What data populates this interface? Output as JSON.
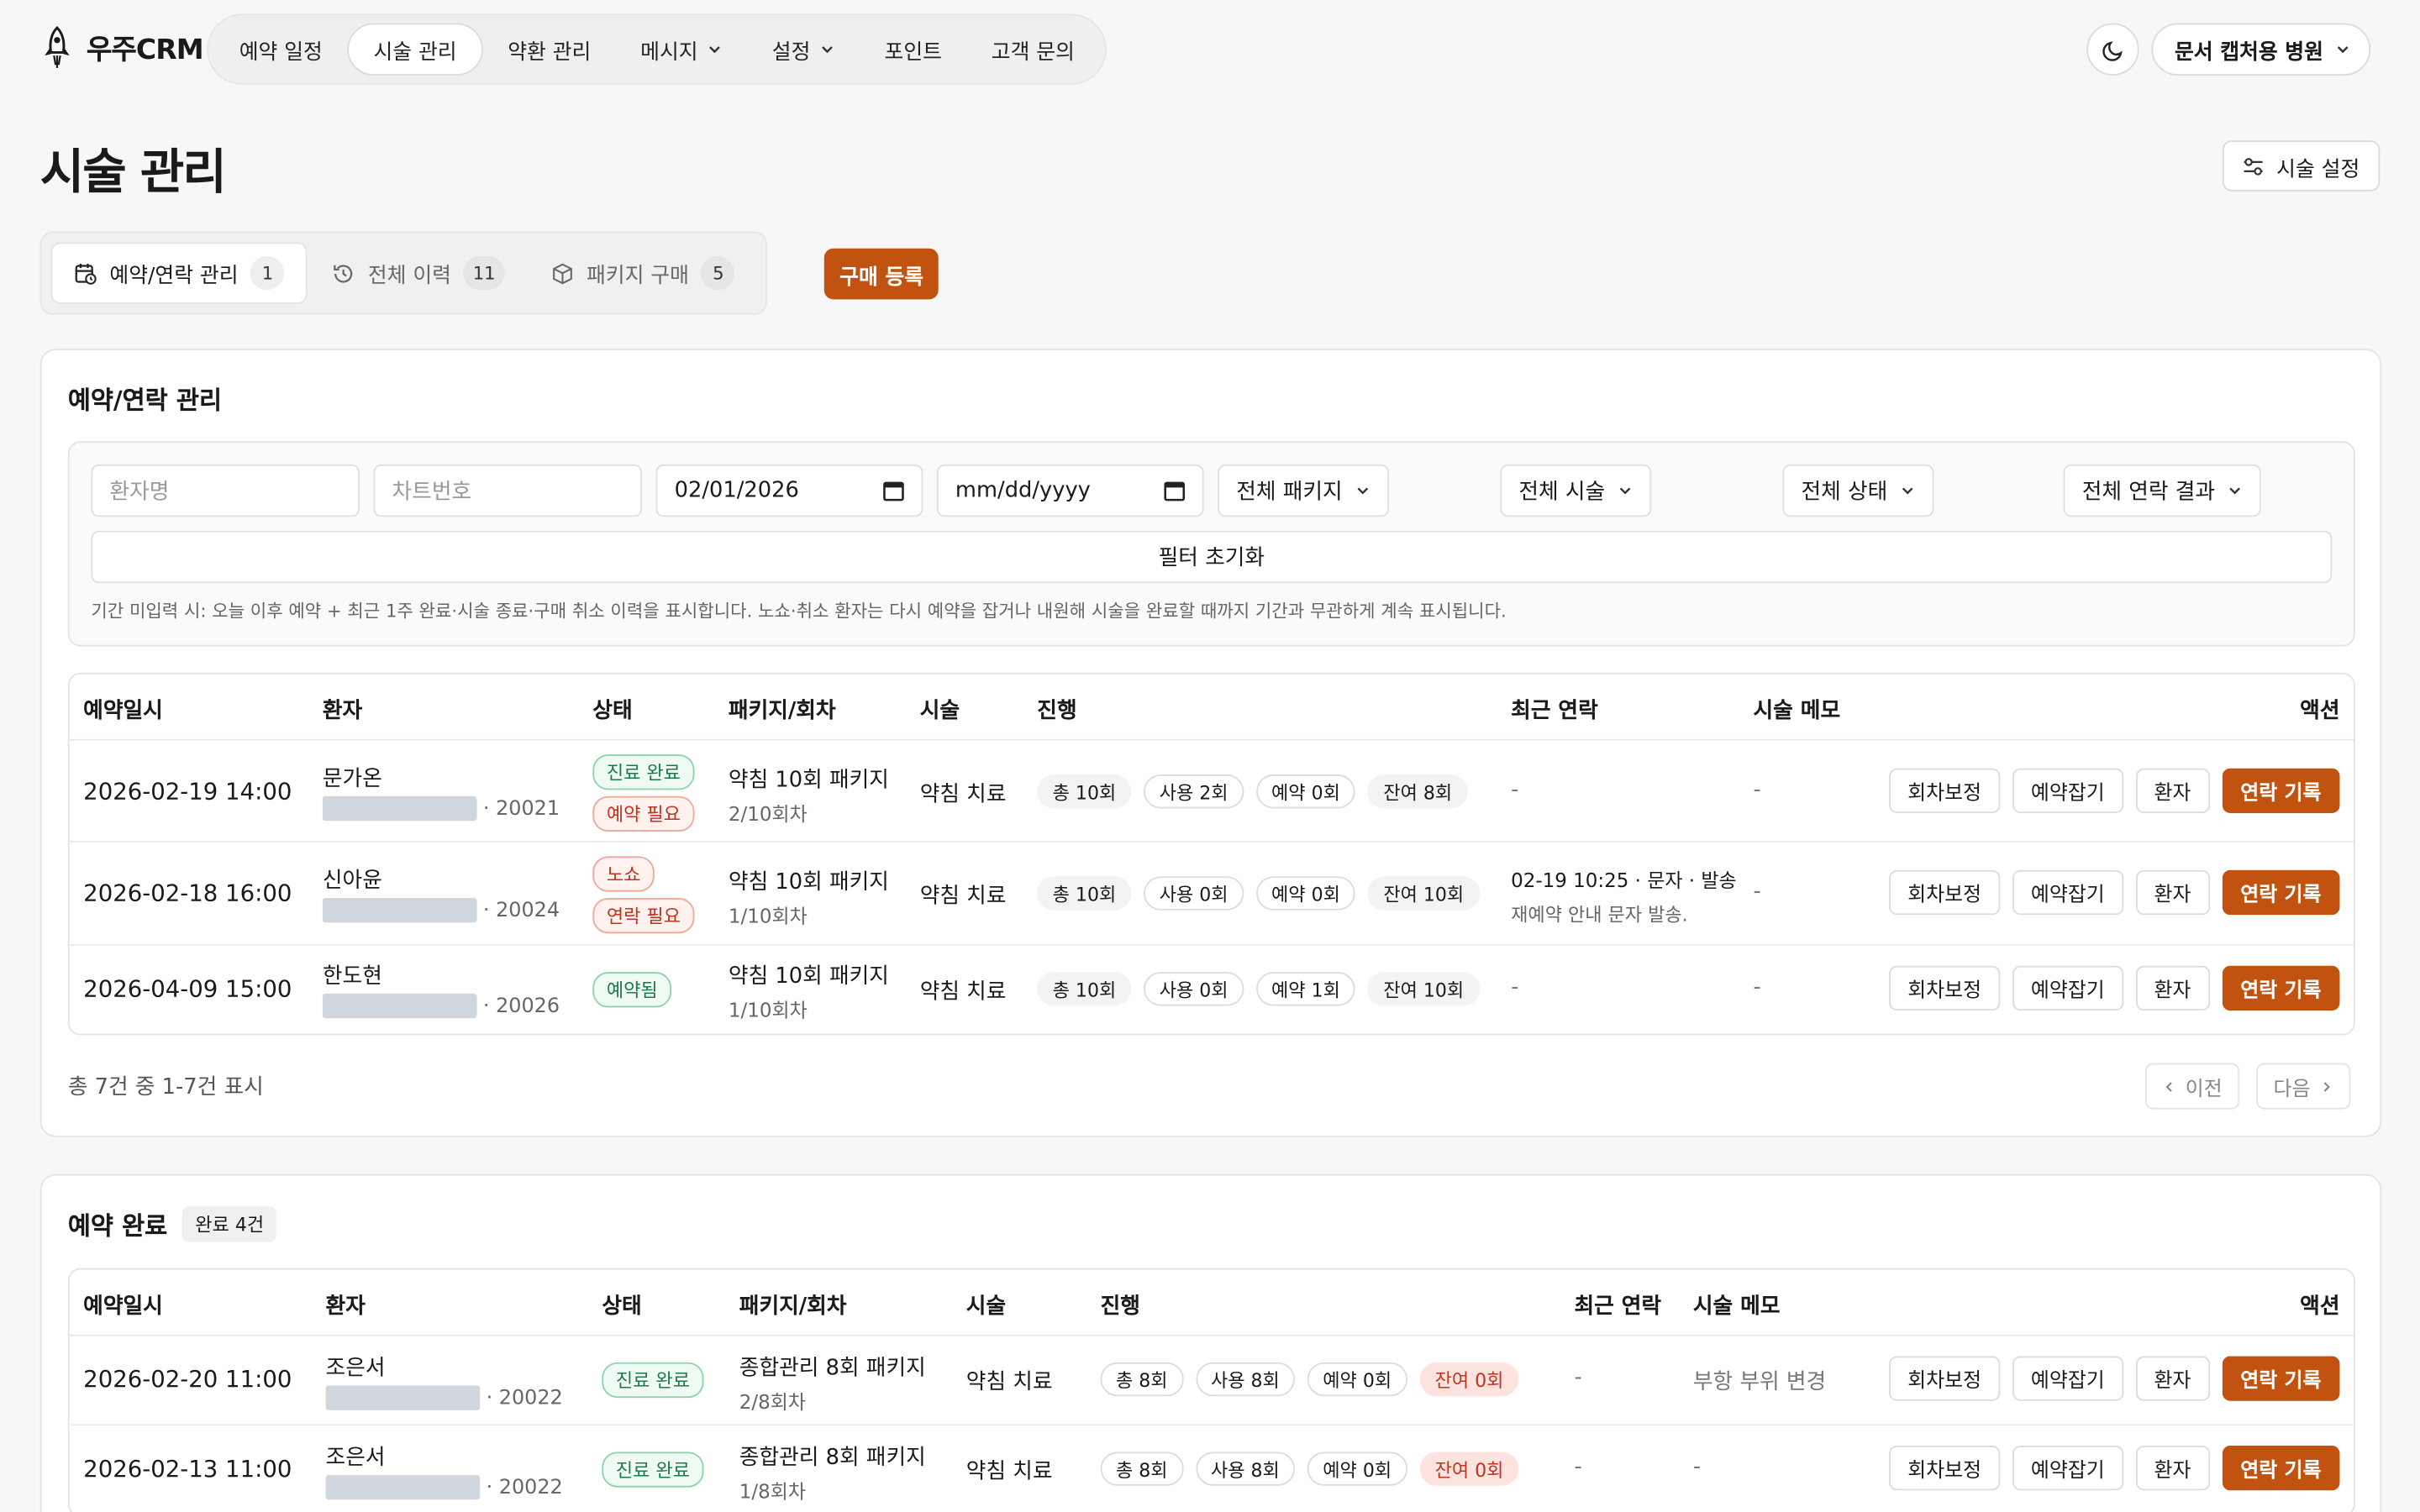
{
  "app": {
    "logo_text": "우주CRM"
  },
  "nav": {
    "items": [
      {
        "label": "예약 일정"
      },
      {
        "label": "시술 관리"
      },
      {
        "label": "약환 관리"
      },
      {
        "label": "메시지"
      },
      {
        "label": "설정"
      },
      {
        "label": "포인트"
      },
      {
        "label": "고객 문의"
      }
    ],
    "clinic": "문서 캡처용 병원"
  },
  "page": {
    "title": "시술 관리",
    "settings_label": "시술 설정"
  },
  "tabs": [
    {
      "label": "예약/연락 관리",
      "count": "1"
    },
    {
      "label": "전체 이력",
      "count": "11"
    },
    {
      "label": "패키지 구매",
      "count": "5"
    }
  ],
  "buy_button": "구매 등록",
  "section1": {
    "title": "예약/연락 관리",
    "filters": {
      "patient_placeholder": "환자명",
      "chart_placeholder": "차트번호",
      "date_from": "02/01/2026",
      "date_to": "mm/dd/yyyy",
      "package": "전체 패키지",
      "procedure": "전체 시술",
      "status": "전체 상태",
      "contact_result": "전체 연락 결과",
      "reset": "필터 초기화",
      "note": "기간 미입력 시: 오늘 이후 예약 + 최근 1주 완료·시술 종료·구매 취소 이력을 표시합니다. 노쇼·취소 환자는 다시 예약을 잡거나 내원해 시술을 완료할 때까지 기간과 무관하게 계속 표시됩니다."
    },
    "columns": [
      "예약일시",
      "환자",
      "상태",
      "패키지/회차",
      "시술",
      "진행",
      "최근 연락",
      "시술 메모",
      "액션"
    ],
    "rows": [
      {
        "datetime": "2026-02-19 14:00",
        "name": "문가온",
        "chart": "· 20021",
        "status": [
          "진료 완료",
          "예약 필요"
        ],
        "package": "약침 10회 패키지",
        "round": "2/10회차",
        "procedure": "약침 치료",
        "chips": [
          "총 10회",
          "사용 2회",
          "예약 0회",
          "잔여 8회"
        ],
        "contact": "-",
        "contact_sub": "",
        "memo": "-"
      },
      {
        "datetime": "2026-02-18 16:00",
        "name": "신아윤",
        "chart": "· 20024",
        "status": [
          "노쇼",
          "연락 필요"
        ],
        "package": "약침 10회 패키지",
        "round": "1/10회차",
        "procedure": "약침 치료",
        "chips": [
          "총 10회",
          "사용 0회",
          "예약 0회",
          "잔여 10회"
        ],
        "contact": "02-19 10:25 · 문자 · 발송",
        "contact_sub": "재예약 안내 문자 발송.",
        "memo": "-"
      },
      {
        "datetime": "2026-04-09 15:00",
        "name": "한도현",
        "chart": "· 20026",
        "status": [
          "예약됨"
        ],
        "package": "약침 10회 패키지",
        "round": "1/10회차",
        "procedure": "약침 치료",
        "chips": [
          "총 10회",
          "사용 0회",
          "예약 1회",
          "잔여 10회"
        ],
        "contact": "-",
        "contact_sub": "",
        "memo": "-"
      }
    ],
    "actions": [
      "회차보정",
      "예약잡기",
      "환자",
      "연락 기록"
    ],
    "pager": {
      "text": "총 7건 중 1-7건 표시",
      "prev": "이전",
      "next": "다음"
    }
  },
  "section2": {
    "title": "예약 완료",
    "badge": "완료 4건",
    "columns": [
      "예약일시",
      "환자",
      "상태",
      "패키지/회차",
      "시술",
      "진행",
      "최근 연락",
      "시술 메모",
      "액션"
    ],
    "rows": [
      {
        "datetime": "2026-02-20 11:00",
        "name": "조은서",
        "chart": "· 20022",
        "status": [
          "진료 완료"
        ],
        "package": "종합관리 8회 패키지",
        "round": "2/8회차",
        "procedure": "약침 치료",
        "chips": [
          "총 8회",
          "사용 8회",
          "예약 0회",
          "잔여 0회"
        ],
        "contact": "-",
        "memo": "부항 부위 변경"
      },
      {
        "datetime": "2026-02-13 11:00",
        "name": "조은서",
        "chart": "· 20022",
        "status": [
          "진료 완료"
        ],
        "package": "종합관리 8회 패키지",
        "round": "1/8회차",
        "procedure": "약침 치료",
        "chips": [
          "총 8회",
          "사용 8회",
          "예약 0회",
          "잔여 0회"
        ],
        "contact": "-",
        "memo": "-"
      }
    ]
  },
  "colors": {
    "accent": "#c2520f",
    "green": "#1e7a4a",
    "red": "#c0341d"
  }
}
